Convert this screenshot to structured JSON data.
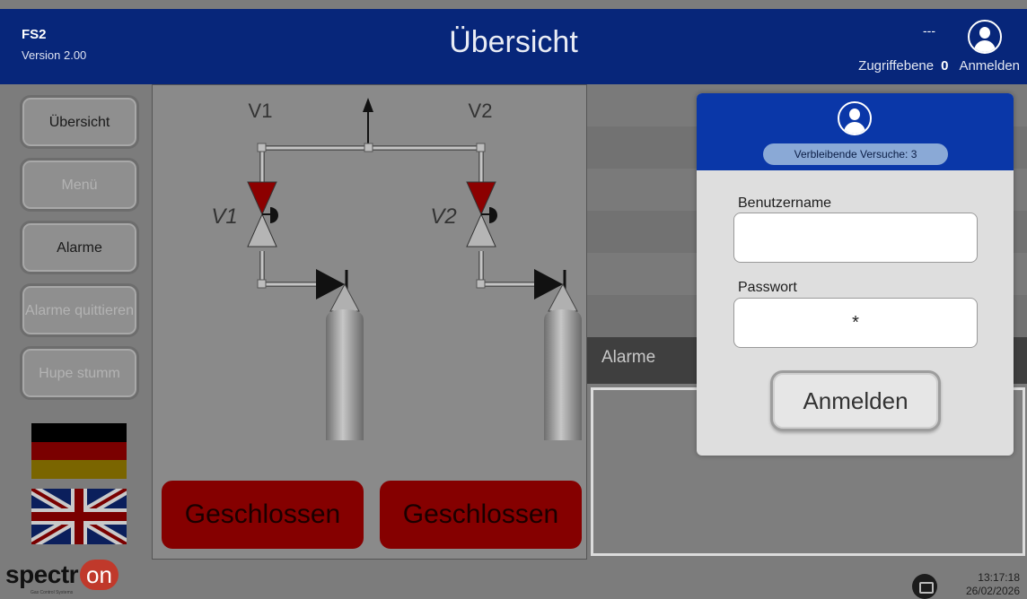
{
  "header": {
    "app_name": "FS2",
    "version": "Version 2.00",
    "title": "Übersicht",
    "user_status": "---",
    "access_label": "Zugriffebene",
    "access_level": "0",
    "login_label": "Anmelden",
    "icon": "user-icon"
  },
  "sidebar": {
    "items": [
      {
        "label": "Übersicht",
        "enabled": true
      },
      {
        "label": "Menü",
        "enabled": false
      },
      {
        "label": "Alarme",
        "enabled": true
      },
      {
        "label": "Alarme quittieren",
        "enabled": false
      },
      {
        "label": "Hupe stumm",
        "enabled": false
      }
    ],
    "flags": [
      "flag-germany",
      "flag-united-kingdom"
    ]
  },
  "process": {
    "column_labels": [
      "V1",
      "V2"
    ],
    "valves": [
      {
        "tag": "V1",
        "state": "Geschlossen"
      },
      {
        "tag": "V2",
        "state": "Geschlossen"
      }
    ]
  },
  "alarms": {
    "header": "Alarme"
  },
  "footer": {
    "logo_text": "spectr",
    "logo_accent": "on",
    "logo_tagline": "Gas Control Systems",
    "time": "13:17:18",
    "date": "26/02/2026",
    "icon": "book-icon"
  },
  "login_dialog": {
    "attempts": "Verbleibende Versuche: 3",
    "username_label": "Benutzername",
    "username_value": "",
    "password_label": "Passwort",
    "password_value": "*",
    "submit_label": "Anmelden"
  },
  "colors": {
    "header_bg": "#07267a",
    "dialog_header_bg": "#0a37a8",
    "valve_closed": "#850000",
    "background": "#7c7c7c"
  }
}
